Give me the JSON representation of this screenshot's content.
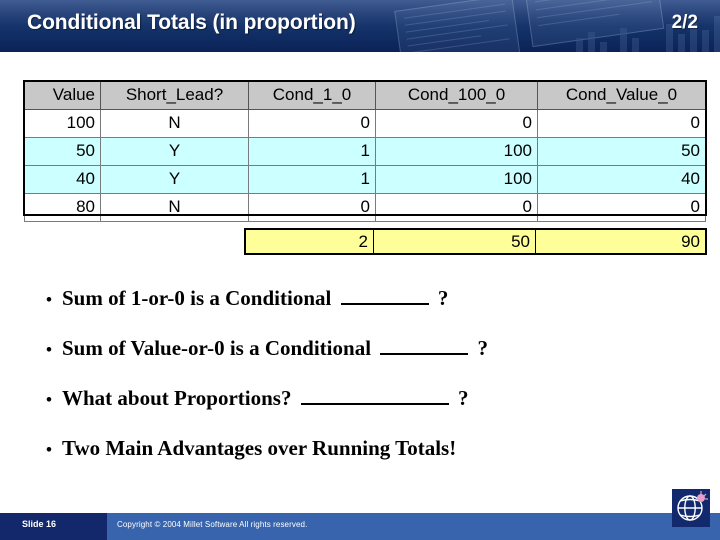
{
  "header": {
    "title": "Conditional Totals (in proportion)",
    "counter": "2/2",
    "bg_color": "#123066",
    "text_color": "#ffffff"
  },
  "table": {
    "columns": [
      "Value",
      "Short_Lead?",
      "Cond_1_0",
      "Cond_100_0",
      "Cond_Value_0"
    ],
    "rows": [
      {
        "cells": [
          "100",
          "N",
          "0",
          "0",
          "0"
        ],
        "highlight": false
      },
      {
        "cells": [
          "50",
          "Y",
          "1",
          "100",
          "50"
        ],
        "highlight": true
      },
      {
        "cells": [
          "40",
          "Y",
          "1",
          "100",
          "40"
        ],
        "highlight": true
      },
      {
        "cells": [
          "80",
          "N",
          "0",
          "0",
          "0"
        ],
        "highlight": false
      }
    ],
    "header_bg": "#c8c8c8",
    "highlight_bg": "#ccffff"
  },
  "totals": {
    "cond_1_0": "2",
    "cond_100_0": "50",
    "cond_value_0": "90",
    "bg_color": "#ffff99"
  },
  "bullets": [
    {
      "dot": "•",
      "pre": "Sum of 1-or-0 is a Conditional",
      "blank": "small",
      "post": "?"
    },
    {
      "dot": "•",
      "pre": "Sum of Value-or-0 is a Conditional",
      "blank": "small",
      "post": "?"
    },
    {
      "dot": "•",
      "pre": "What about Proportions?",
      "blank": "large",
      "post": "?"
    },
    {
      "dot": "•",
      "pre": "Two Main Advantages over Running Totals!",
      "blank": "none",
      "post": ""
    }
  ],
  "footer": {
    "slide_label": "Slide 16",
    "copyright": "Copyright © 2004 Millet Software All rights reserved.",
    "bar_color": "#3863ad",
    "chip_color": "#12286b",
    "logo_icon": "globe-icon"
  }
}
